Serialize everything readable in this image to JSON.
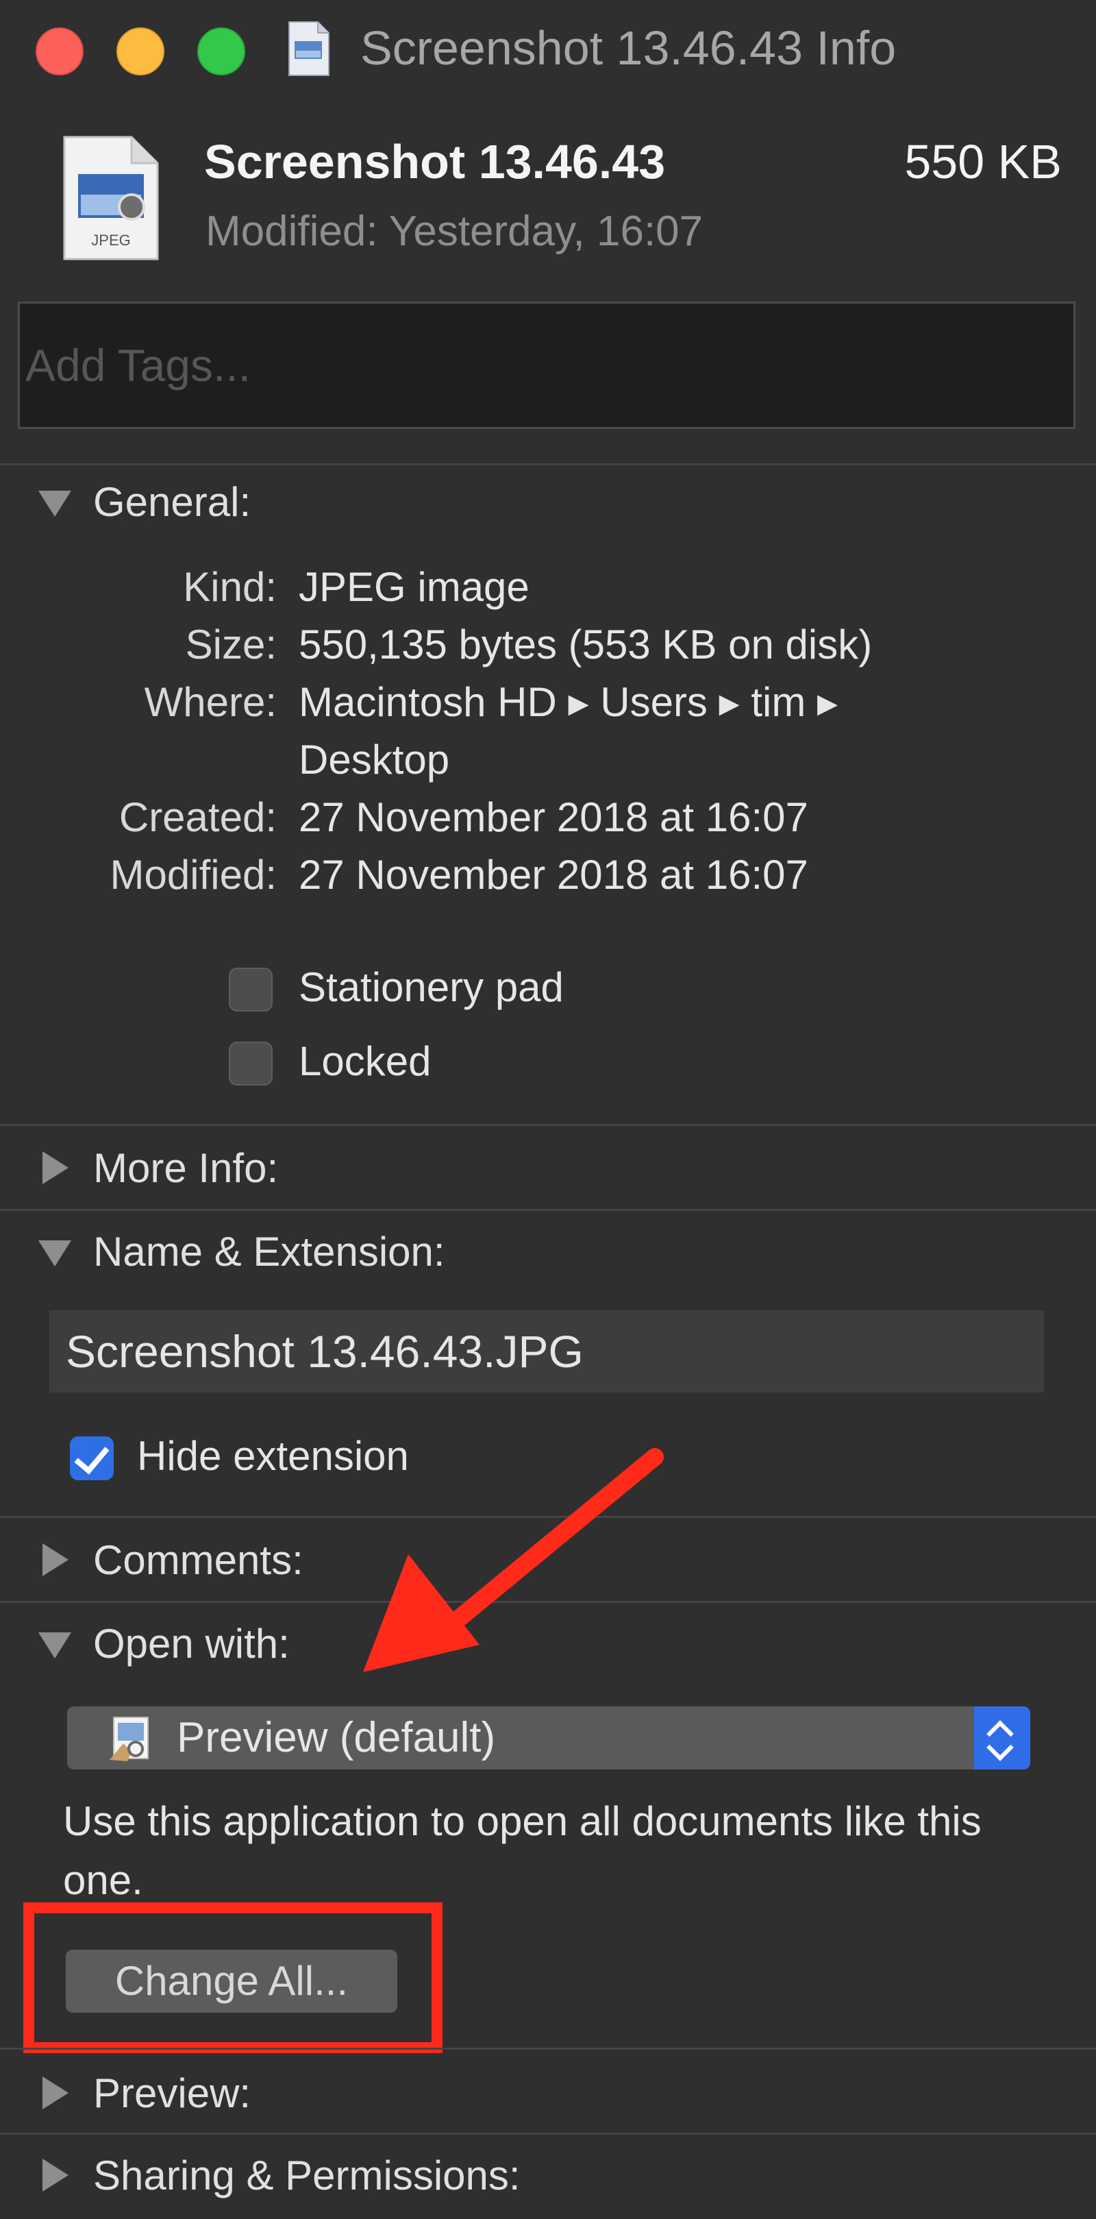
{
  "window": {
    "title": "Screenshot 13.46.43 Info"
  },
  "header": {
    "file_name": "Screenshot 13.46.43",
    "file_size": "550 KB",
    "modified": "Modified:  Yesterday, 16:07",
    "file_icon_label": "JPEG"
  },
  "tags": {
    "placeholder": "Add Tags..."
  },
  "sections": {
    "general": "General:",
    "more_info": "More Info:",
    "name_extension": "Name & Extension:",
    "comments": "Comments:",
    "open_with": "Open with:",
    "preview": "Preview:",
    "sharing": "Sharing & Permissions:"
  },
  "general": {
    "kind_label": "Kind:",
    "kind_value": "JPEG image",
    "size_label": "Size:",
    "size_value": "550,135 bytes (553 KB on disk)",
    "where_label": "Where:",
    "where_value_line1": "Macintosh HD ▸ Users ▸ tim ▸",
    "where_value_line2": "Desktop",
    "created_label": "Created:",
    "created_value": "27 November 2018 at 16:07",
    "modified_label": "Modified:",
    "modified_value": "27 November 2018 at 16:07",
    "stationery_label": "Stationery pad",
    "stationery_checked": false,
    "locked_label": "Locked",
    "locked_checked": false
  },
  "name_extension": {
    "file_name_value": "Screenshot 13.46.43.JPG",
    "hide_extension_label": "Hide extension",
    "hide_extension_checked": true
  },
  "open_with": {
    "selected_app": "Preview (default)",
    "help_text": "Use this application to open all documents like this one.",
    "change_all_label": "Change All..."
  },
  "colors": {
    "accent_blue": "#2e6fe6",
    "annotation_red": "#ff2a1a",
    "window_bg": "#2f2f2f"
  },
  "icons": {
    "close": "close-button",
    "minimize": "minimize-button",
    "zoom": "zoom-button",
    "file": "jpeg-file-icon",
    "app": "preview-app-icon"
  }
}
